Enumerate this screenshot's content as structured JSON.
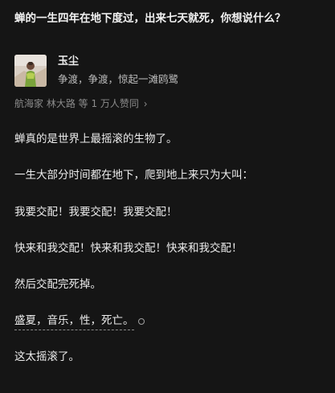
{
  "question": {
    "title": "蝉的一生四年在地下度过，出来七天就死，你想说什么？"
  },
  "author": {
    "name": "玉尘",
    "bio": "争渡，争渡，惊起一滩鸥鹭",
    "avatar_icon": "avatar-photo-icon"
  },
  "upvoters": {
    "text": "航海家 林大路 等 1 万人赞同",
    "chevron": "›"
  },
  "answer": {
    "paragraphs": [
      "蝉真的是世界上最摇滚的生物了。",
      "一生大部分时间都在地下，爬到地上来只为大叫：",
      "我要交配！我要交配！我要交配！",
      "快来和我交配！快来和我交配！快来和我交配！",
      "然后交配完死掉。",
      "盛夏，音乐，性，死亡。",
      "这太摇滚了。"
    ]
  },
  "colors": {
    "background": "#151515",
    "text": "#ececec",
    "muted": "#8c8c8c"
  }
}
